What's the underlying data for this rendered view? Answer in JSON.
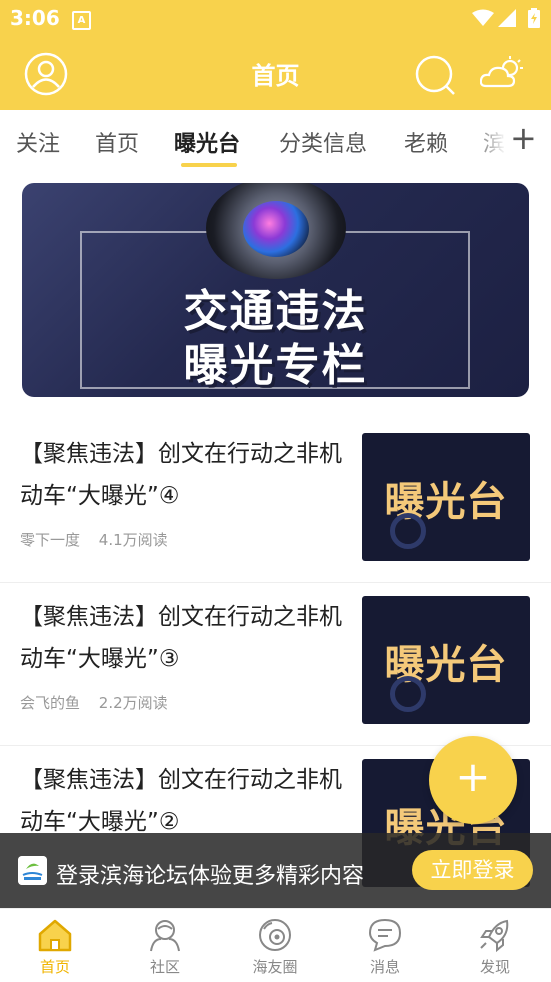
{
  "status_bar": {
    "time": "3:06",
    "notification_icon_letter": "A"
  },
  "header": {
    "title": "首页"
  },
  "tabs": [
    {
      "label": "关注"
    },
    {
      "label": "首页"
    },
    {
      "label": "曝光台"
    },
    {
      "label": "分类信息"
    },
    {
      "label": "老赖"
    },
    {
      "label": "滨"
    }
  ],
  "tabs_add": "+",
  "banner": {
    "line1": "交通违法",
    "line2": "曝光专栏"
  },
  "articles": [
    {
      "title": "【聚焦违法】创文在行动之非机动车“大曝光”④",
      "author": "零下一度",
      "reads": "4.1万阅读",
      "thumb_text": "曝光台"
    },
    {
      "title": "【聚焦违法】创文在行动之非机动车“大曝光”③",
      "author": "会飞的鱼",
      "reads": "2.2万阅读",
      "thumb_text": "曝光台"
    },
    {
      "title": "【聚焦违法】创文在行动之非机动车“大曝光”②",
      "author": "",
      "reads": "",
      "thumb_text": "曝光台"
    }
  ],
  "fab": {
    "label": "+"
  },
  "login_bar": {
    "text": "登录滨海论坛体验更多精彩内容",
    "button": "立即登录"
  },
  "bottom_nav": [
    {
      "label": "首页",
      "icon": "home-icon",
      "active": true
    },
    {
      "label": "社区",
      "icon": "community-icon",
      "active": false
    },
    {
      "label": "海友圈",
      "icon": "friends-circle-icon",
      "active": false
    },
    {
      "label": "消息",
      "icon": "message-icon",
      "active": false
    },
    {
      "label": "发现",
      "icon": "discover-rocket-icon",
      "active": false
    }
  ],
  "colors": {
    "brand_yellow": "#f8d24c",
    "active_nav": "#f0b400",
    "thumb_bg": "#161a33",
    "thumb_text": "#f4c97a"
  }
}
